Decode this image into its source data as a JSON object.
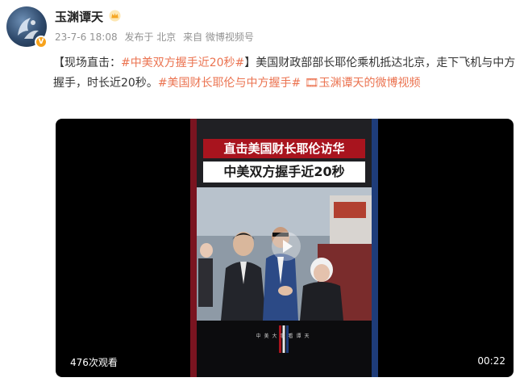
{
  "author": {
    "name": "玉渊谭天",
    "avatar_icon": "avatar-logo-icon",
    "verified_badge": "V",
    "crown_icon": "crown-icon",
    "crown_color": "#f5a623"
  },
  "meta": {
    "time": "23-7-6 18:08",
    "published_in": "发布于 北京",
    "source": "来自 微博视频号"
  },
  "post": {
    "prefix": "【现场直击：",
    "topic1": "#中美双方握手近20秒#",
    "mid": "】美国财政部部长耶伦乘机抵达北京，走下飞机与中方握手，时长近20秒。",
    "topic2": "#美国财长耶伦与中方握手#",
    "video_link": "🎞玉渊谭天的微博视频",
    "link_color": "#eb7350"
  },
  "video": {
    "caption_line1": "直击美国财长耶伦访华",
    "caption_line2": "中美双方握手近20秒",
    "subtitle": "中美大事看谭天",
    "views": "476次观看",
    "duration": "00:22",
    "play_icon": "play-icon"
  }
}
